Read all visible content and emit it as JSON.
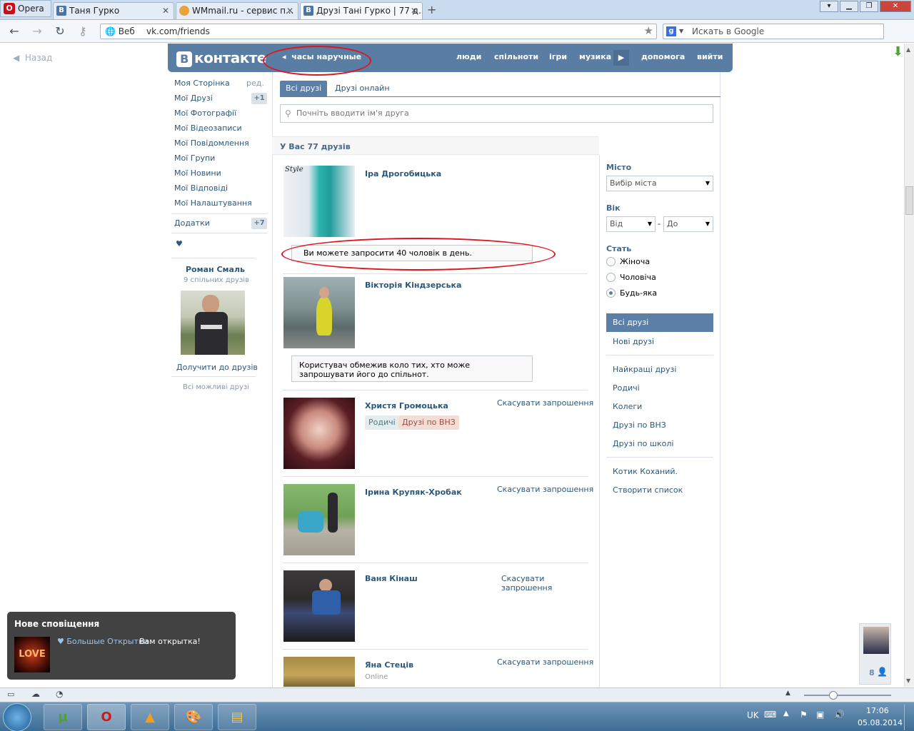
{
  "browser": {
    "app_label": "Opera",
    "tabs": [
      {
        "label": "Таня Гурко"
      },
      {
        "label": "WMmail.ru - сервис п..."
      },
      {
        "label": "Друзі Тані Гурко | 77 д..."
      }
    ],
    "address_prefix": "Веб",
    "url": "vk.com/friends",
    "search_placeholder": "Искать в Google"
  },
  "page": {
    "back_label": "Назад"
  },
  "header": {
    "logo": "контакте",
    "logo_letter": "В",
    "status": "часы наручные",
    "nav": [
      "люди",
      "спільноти",
      "ігри",
      "музика",
      "допомога",
      "вийти"
    ]
  },
  "sidebar": {
    "items": [
      {
        "label": "Моя Сторінка"
      },
      {
        "label": "Мої Друзі"
      },
      {
        "label": "Мої Фотографії"
      },
      {
        "label": "Мої Відеозаписи"
      },
      {
        "label": "Мої Повідомлення"
      },
      {
        "label": "Мої Групи"
      },
      {
        "label": "Мої Новини"
      },
      {
        "label": "Мої Відповіді"
      },
      {
        "label": "Мої Налаштування"
      }
    ],
    "edit_label": "ред.",
    "friends_count": "+1",
    "apps_label": "Додатки",
    "apps_count": "+7",
    "heart": "♥",
    "suggest": {
      "name": "Роман Смаль",
      "mutual": "9 спільних друзів",
      "add_label": "Долучити до друзів",
      "all_label": "Всі можливі друзі"
    }
  },
  "tabs": {
    "all": "Всі друзі",
    "online": "Друзі онлайн"
  },
  "search": {
    "placeholder": "Почніть вводити ім'я друга"
  },
  "summary": "У Вас 77 друзів",
  "friends": [
    {
      "name": "Іра Дрогобицька",
      "photo_caption": "Style",
      "message": "Ви можете запросити 40 чоловік в день."
    },
    {
      "name": "Вікторія Кіндзерська",
      "message": "Користувач обмежив коло тих, хто може запрошувати його до спільнот."
    },
    {
      "name": "Христя Громоцька",
      "action": "Скасувати запрошення",
      "tags": [
        "Родичі",
        "Друзі по ВНЗ"
      ]
    },
    {
      "name": "Ірина Крупяк-Хробак",
      "action": "Скасувати запрошення"
    },
    {
      "name": "Ваня Кінаш",
      "action": "Скасувати запрошення"
    },
    {
      "name": "Яна Стецiв",
      "action": "Скасувати запрошення",
      "status": "Online"
    }
  ],
  "filters": {
    "city_label": "Місто",
    "city_select": "Вибір міста",
    "age_label": "Вік",
    "age_from": "Від",
    "age_dash": "-",
    "age_to": "До",
    "sex_label": "Стать",
    "sex_options": [
      {
        "label": "Жіноча",
        "selected": false
      },
      {
        "label": "Чоловіча",
        "selected": false
      },
      {
        "label": "Будь-яка",
        "selected": true
      }
    ],
    "lists": [
      "Всі друзі",
      "Нові друзі",
      "Найкращі друзі",
      "Родичі",
      "Колеги",
      "Друзі по ВНЗ",
      "Друзі по школі",
      "Котик Коханий.",
      "Створити список"
    ]
  },
  "notification": {
    "title": "Нове сповіщення",
    "thumb_text": "LOVE",
    "source": "♥ Большые Открытки",
    "text": "Вам открытка!"
  },
  "chat_count": "8",
  "taskbar": {
    "lang": "UK",
    "time": "17:06",
    "date": "05.08.2014"
  },
  "colors": {
    "vk_blue": "#597da3",
    "link": "#2b587a",
    "annotation_red": "#e0141e"
  }
}
